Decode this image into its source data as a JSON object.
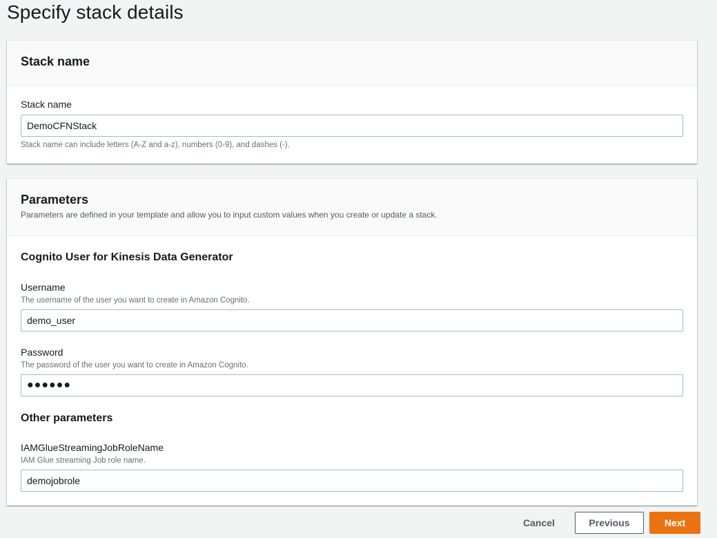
{
  "page": {
    "title": "Specify stack details"
  },
  "stack_name_panel": {
    "header": "Stack name",
    "label": "Stack name",
    "value": "DemoCFNStack",
    "help": "Stack name can include letters (A-Z and a-z), numbers (0-9), and dashes (-)."
  },
  "parameters_panel": {
    "header": "Parameters",
    "description": "Parameters are defined in your template and allow you to input custom values when you create or update a stack.",
    "cognito_section": {
      "title": "Cognito User for Kinesis Data Generator",
      "username": {
        "label": "Username",
        "help": "The username of the user you want to create in Amazon Cognito.",
        "value": "demo_user"
      },
      "password": {
        "label": "Password",
        "help": "The password of the user you want to create in Amazon Cognito.",
        "value": "●●●●●●"
      }
    },
    "other_section": {
      "title": "Other parameters",
      "role": {
        "label": "IAMGlueStreamingJobRoleName",
        "help": "IAM Glue streaming Job role name.",
        "value": "demojobrole"
      }
    }
  },
  "footer": {
    "cancel": "Cancel",
    "previous": "Previous",
    "next": "Next"
  },
  "colors": {
    "primary_button": "#ec7211",
    "background": "#f2f3f3",
    "panel_header": "#fafafa"
  }
}
